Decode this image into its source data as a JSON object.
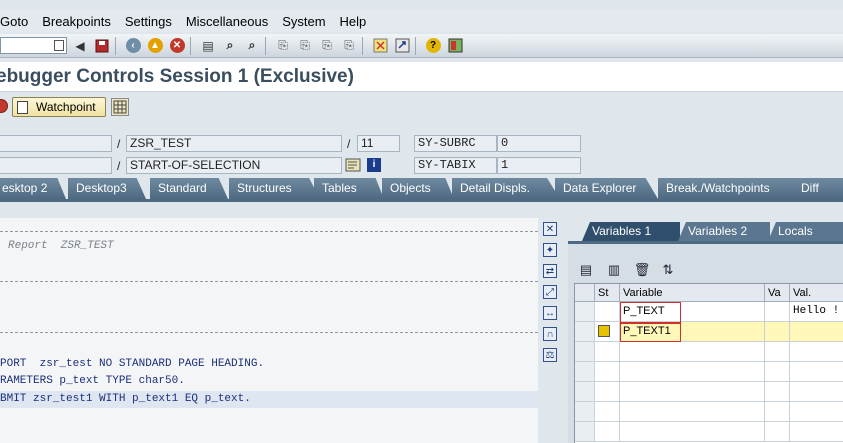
{
  "menu": {
    "items": [
      {
        "label": "Goto"
      },
      {
        "label": "Breakpoints"
      },
      {
        "label": "Settings"
      },
      {
        "label": "Miscellaneous"
      },
      {
        "label": "System"
      },
      {
        "label": "Help"
      }
    ]
  },
  "title": "ebugger Controls Session 1 (Exclusive)",
  "apptoolbar": {
    "watchpoint_label": "Watchpoint"
  },
  "info": {
    "program": "ZSR_TEST",
    "line": "11",
    "event": "START-OF-SELECTION",
    "sysvar1_name": "SY-SUBRC",
    "sysvar1_value": "0",
    "sysvar2_name": "SY-TABIX",
    "sysvar2_value": "1"
  },
  "tabs": [
    {
      "label": "esktop 2"
    },
    {
      "label": "Desktop3"
    },
    {
      "label": "Standard"
    },
    {
      "label": "Structures"
    },
    {
      "label": "Tables"
    },
    {
      "label": "Objects"
    },
    {
      "label": "Detail Displs."
    },
    {
      "label": "Data Explorer"
    },
    {
      "label": "Break./Watchpoints"
    },
    {
      "label": "Diff"
    }
  ],
  "code": {
    "comment": "Report  ZSR_TEST",
    "line1": "PORT  zsr_test NO STANDARD PAGE HEADING.",
    "line2": "RAMETERS p_text TYPE char50.",
    "line3": "BMIT zsr_test1 WITH p_text1 EQ p_text."
  },
  "var_tabs": [
    {
      "label": "Variables 1"
    },
    {
      "label": "Variables 2"
    },
    {
      "label": "Locals"
    }
  ],
  "var_table": {
    "headers": {
      "st": "St",
      "variable": "Variable",
      "va": "Va",
      "val": "Val."
    },
    "rows": [
      {
        "variable": "P_TEXT",
        "value": "Hello !"
      },
      {
        "variable": "P_TEXT1",
        "value": ""
      }
    ]
  },
  "colors": {
    "tab_active": "#2f4f6c",
    "tab_inactive": "#5a7690",
    "title_text": "#3a4e60"
  }
}
